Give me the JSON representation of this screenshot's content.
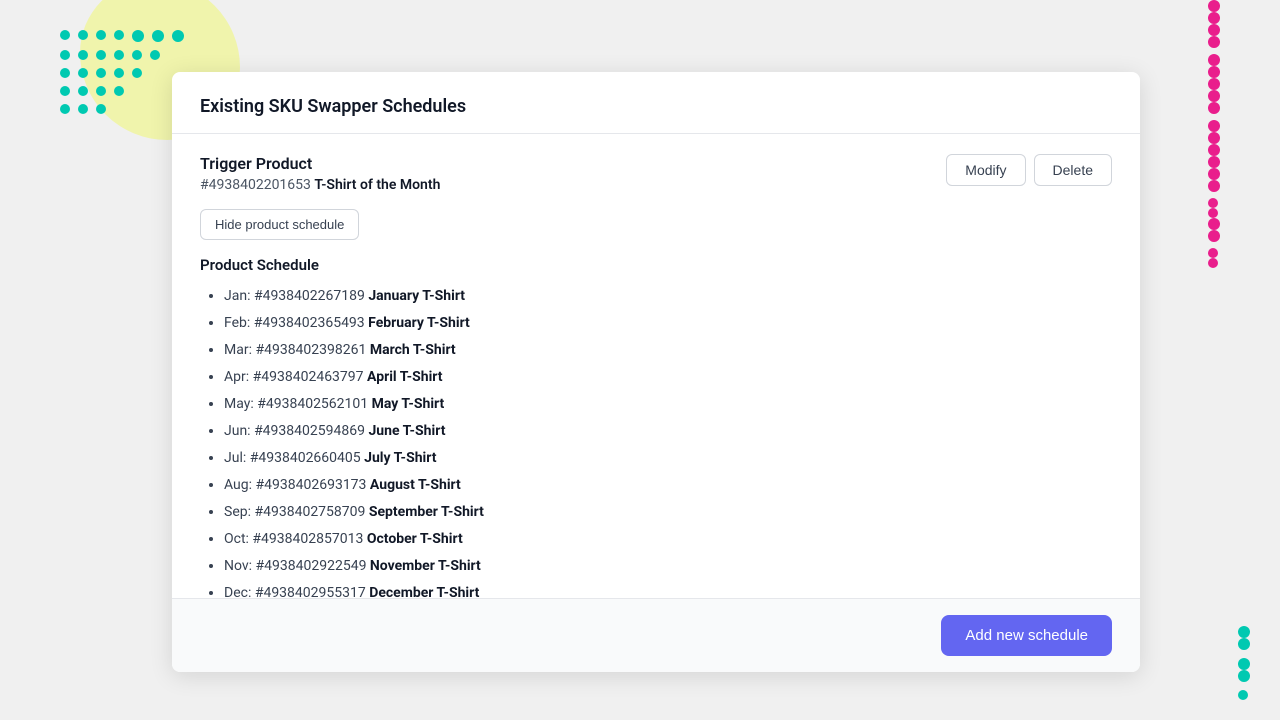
{
  "background": {
    "color": "#f0f0f0"
  },
  "modal": {
    "title": "Existing SKU Swapper Schedules",
    "trigger_section": {
      "label": "Trigger Product",
      "product_id": "#4938402201653",
      "product_name": "T-Shirt of the Month",
      "modify_button": "Modify",
      "delete_button": "Delete",
      "hide_button": "Hide product schedule"
    },
    "schedule_section": {
      "title": "Product Schedule",
      "items": [
        {
          "month": "Jan:",
          "sku": "#4938402267189",
          "name": "January T-Shirt"
        },
        {
          "month": "Feb:",
          "sku": "#4938402365493",
          "name": "February T-Shirt"
        },
        {
          "month": "Mar:",
          "sku": "#4938402398261",
          "name": "March T-Shirt"
        },
        {
          "month": "Apr:",
          "sku": "#4938402463797",
          "name": "April T-Shirt"
        },
        {
          "month": "May:",
          "sku": "#4938402562101",
          "name": "May T-Shirt"
        },
        {
          "month": "Jun:",
          "sku": "#4938402594869",
          "name": "June T-Shirt"
        },
        {
          "month": "Jul:",
          "sku": "#4938402660405",
          "name": "July T-Shirt"
        },
        {
          "month": "Aug:",
          "sku": "#4938402693173",
          "name": "August T-Shirt"
        },
        {
          "month": "Sep:",
          "sku": "#4938402758709",
          "name": "September T-Shirt"
        },
        {
          "month": "Oct:",
          "sku": "#4938402857013",
          "name": "October T-Shirt"
        },
        {
          "month": "Nov:",
          "sku": "#4938402922549",
          "name": "November T-Shirt"
        },
        {
          "month": "Dec:",
          "sku": "#4938402955317",
          "name": "December T-Shirt"
        }
      ]
    },
    "footer": {
      "add_button": "Add new schedule"
    }
  }
}
